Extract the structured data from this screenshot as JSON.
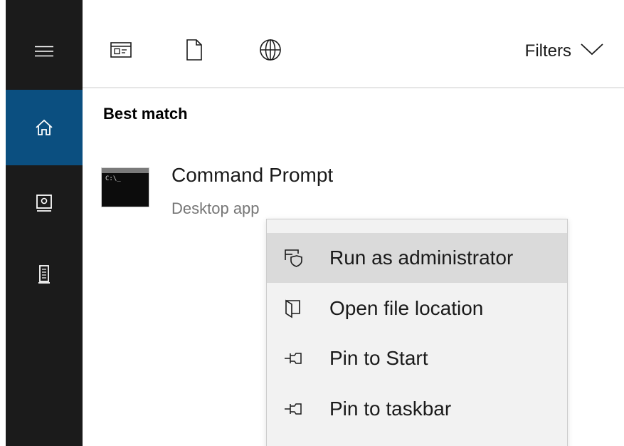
{
  "sidebar": {
    "items": [
      {
        "name": "menu",
        "icon": "hamburger-menu-icon"
      },
      {
        "name": "home",
        "icon": "home-icon",
        "active": true
      },
      {
        "name": "documents",
        "icon": "notebook-icon"
      },
      {
        "name": "devices",
        "icon": "tower-device-icon"
      }
    ],
    "active_color": "#0b4f80"
  },
  "toolbar": {
    "scope_icons": [
      "apps-icon",
      "document-icon",
      "web-globe-icon"
    ],
    "filters_label": "Filters"
  },
  "results": {
    "section_heading": "Best match",
    "best_match": {
      "title": "Command Prompt",
      "subtitle": "Desktop app",
      "icon": "command-prompt-icon",
      "icon_text": "C:\\_"
    }
  },
  "context_menu": {
    "items": [
      {
        "label": "Run as administrator",
        "icon": "shield-admin-icon",
        "highlighted": true
      },
      {
        "label": "Open file location",
        "icon": "folder-location-icon",
        "highlighted": false
      },
      {
        "label": "Pin to Start",
        "icon": "pin-icon",
        "highlighted": false
      },
      {
        "label": "Pin to taskbar",
        "icon": "pin-icon",
        "highlighted": false
      }
    ],
    "highlight_color": "#dadada"
  }
}
